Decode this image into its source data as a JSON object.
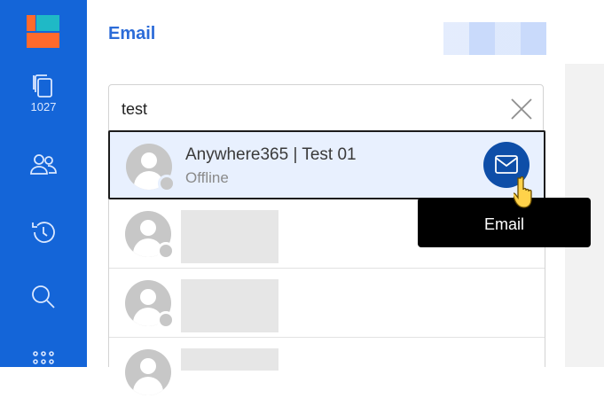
{
  "sidebar": {
    "items": [
      {
        "name": "documents",
        "icon": "copy-icon",
        "count": "1027"
      },
      {
        "name": "contacts",
        "icon": "people-icon"
      },
      {
        "name": "history",
        "icon": "history-icon"
      },
      {
        "name": "search",
        "icon": "search-icon"
      },
      {
        "name": "apps",
        "icon": "grid-icon"
      }
    ]
  },
  "header": {
    "title": "Email"
  },
  "search": {
    "value": "test"
  },
  "results": [
    {
      "name": "Anywhere365 | Test 01",
      "status": "Offline"
    }
  ],
  "tooltip": {
    "label": "Email"
  },
  "colors": {
    "sidebar": "#1465d8",
    "accent": "#2c6cd8",
    "action": "#0e4ea8",
    "selected_row": "#e8f0fe"
  }
}
